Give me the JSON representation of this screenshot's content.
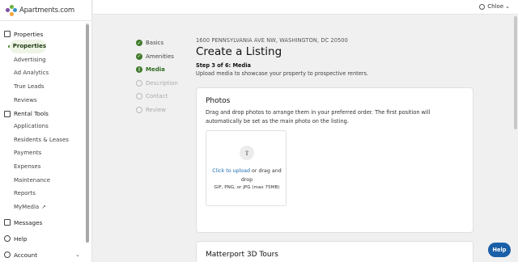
{
  "brand": {
    "name": "Apartments.com"
  },
  "user": {
    "name": "Chloe",
    "caret": "⌄"
  },
  "sidebar": {
    "sections": [
      {
        "label": "Properties",
        "icon": "building-icon"
      },
      {
        "label": "Rental Tools",
        "icon": "clipboard-icon"
      },
      {
        "label": "Messages",
        "icon": "envelope-icon"
      },
      {
        "label": "Help",
        "icon": "globe-icon"
      },
      {
        "label": "Account",
        "icon": "gear-icon"
      }
    ],
    "properties_items": [
      "Properties",
      "Advertising",
      "Ad Analytics",
      "True Leads",
      "Reviews"
    ],
    "rental_items": [
      "Applications",
      "Residents & Leases",
      "Payments",
      "Expenses",
      "Maintenance",
      "Reports",
      "MyMedia"
    ],
    "account_caret": "⌄"
  },
  "steps": [
    {
      "label": "Basics",
      "state": "done"
    },
    {
      "label": "Amenities",
      "state": "done"
    },
    {
      "label": "Media",
      "state": "current"
    },
    {
      "label": "Description",
      "state": "todo"
    },
    {
      "label": "Contact",
      "state": "todo"
    },
    {
      "label": "Review",
      "state": "todo"
    }
  ],
  "main": {
    "address": "1600 PENNSYLVANIA AVE NW, WASHINGTON, DC 20500",
    "title": "Create a Listing",
    "step_label": "Step 3 of 6: Media",
    "step_desc": "Upload media to showcase your property to prospective renters."
  },
  "photos": {
    "title": "Photos",
    "desc": "Drag and drop photos to arrange them in your preferred order. The first position will automatically be set as the main photo on the listing.",
    "upload_link": "Click to upload",
    "upload_rest": " or drag and drop",
    "formats": "GIF, PNG, or JPG (max 75MB)"
  },
  "matterport": {
    "title": "Matterport 3D Tours"
  },
  "help_button": "Help",
  "colors": {
    "accent": "#3f7a2a",
    "link": "#1c6bb0",
    "help": "#1a5fa8"
  }
}
